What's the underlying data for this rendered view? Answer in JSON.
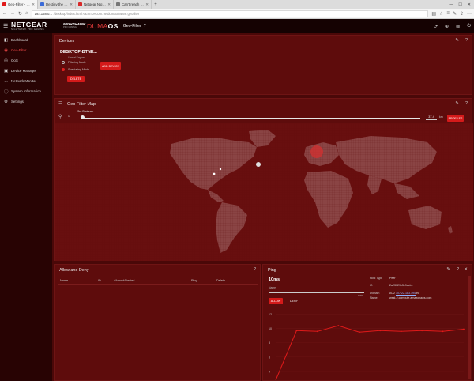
{
  "browser": {
    "tabs": [
      {
        "label": "Geo-Filter - DumaOS",
        "active": true,
        "color": "#e01a1a"
      },
      {
        "label": "Destiny the Game | Gratis p",
        "active": false,
        "color": "#3b6bd8"
      },
      {
        "label": "Netgear Nighthawk Pro XR",
        "active": false,
        "color": "#d82a2a"
      },
      {
        "label": "Can't reach this page",
        "active": false,
        "color": "#777777"
      }
    ],
    "url_host": "192.168.0.1",
    "url_path": "/desktop/index.html?actn=0#com.netdumaoftware.geofilter"
  },
  "header": {
    "brand": "NETGEAR",
    "brand_sub": "NIGHTHAWK PRO GAMING",
    "hawk": "NIGHTHAWK",
    "hawk_sub": "PRO GAMING",
    "duma_prefix": "DUMA",
    "duma_suffix": "OS",
    "crumb": "Geo-Filter"
  },
  "sidebar": {
    "items": [
      {
        "label": "Dashboard",
        "icon": "dashboard-icon",
        "glyph": "◧",
        "active": false
      },
      {
        "label": "Geo-Filter",
        "icon": "geo-filter-icon",
        "glyph": "◉",
        "active": true
      },
      {
        "label": "QoS",
        "icon": "qos-icon",
        "glyph": "◎",
        "active": false
      },
      {
        "label": "Device Manager",
        "icon": "device-manager-icon",
        "glyph": "▣",
        "active": false
      },
      {
        "label": "Network Monitor",
        "icon": "network-monitor-icon",
        "glyph": "〰",
        "active": false
      },
      {
        "label": "System Information",
        "icon": "system-information-icon",
        "glyph": "ⓘ",
        "active": false
      },
      {
        "label": "Settings",
        "icon": "settings-icon",
        "glyph": "⚙",
        "active": false
      }
    ]
  },
  "devices": {
    "title": "Devices",
    "device_name": "DESKTOP-BTNE...",
    "device_sub": "Unreal Engine",
    "mode_filtering": "Filtering Mode",
    "mode_spectating": "Spectating Mode",
    "delete": "DELETE",
    "add_device": "ADD DEVICE"
  },
  "map": {
    "title": "Geo-Filter Map",
    "slider_label": "Set Distance",
    "distance_value": "37.4",
    "distance_unit": "km",
    "profiles": "PROFILES",
    "colors": {
      "water": "#680f0f",
      "land": "#8a4444",
      "highlight": "#d43030"
    }
  },
  "allow_deny": {
    "title": "Allow and Deny",
    "columns": [
      "Name",
      "ID",
      "Allowed/Denied",
      "Ping",
      "Delete"
    ]
  },
  "ping": {
    "title": "Ping",
    "value": "10ms",
    "name_label": "Name",
    "slider_tick": "0:00",
    "host_type_label": "Host Type",
    "host_type_value": "Peer",
    "id_label": "ID",
    "id_value": "2a23029b5c9acb1",
    "domain_label": "Domain",
    "domain_ip": "107.22.183.194",
    "domain_suffix": "ec",
    "name_value": "west-2.compute.amazonaws.com",
    "allow": "ALLOW",
    "deny": "DENY",
    "chart_data": {
      "type": "line",
      "y_ticks": [
        "12",
        "10",
        "8",
        "6",
        "4"
      ],
      "ylim": [
        3,
        12.5
      ],
      "x": [
        0,
        1,
        2,
        3,
        4,
        5,
        6,
        7,
        8,
        9
      ],
      "values": [
        2,
        9.7,
        9.6,
        10.4,
        9.5,
        9.7,
        9.6,
        9.7,
        9.6,
        9.9
      ],
      "color": "#e01a1a"
    }
  }
}
